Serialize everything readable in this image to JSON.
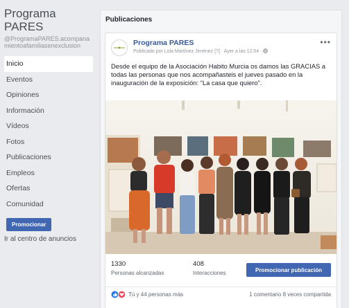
{
  "sidebar": {
    "page_name": "Programa PARES",
    "page_handle": "@ProgramaPARES.acompanamientoafamiliasenexclusion",
    "nav_items": [
      {
        "label": "Inicio"
      },
      {
        "label": "Eventos"
      },
      {
        "label": "Opiniones"
      },
      {
        "label": "Información"
      },
      {
        "label": "Vídeos"
      },
      {
        "label": "Fotos"
      },
      {
        "label": "Publicaciones"
      },
      {
        "label": "Empleos"
      },
      {
        "label": "Ofertas"
      },
      {
        "label": "Comunidad"
      }
    ],
    "promote_label": "Promocionar",
    "ads_center_label": "Ir al centro de anuncios"
  },
  "main": {
    "section_title": "Publicaciones",
    "post": {
      "author": "Programa PARES",
      "meta": "Publicado por Lola Martínez Jiménez [?] · Ayer a las 12:54 · ",
      "more_label": "•••",
      "text": "Desde el equipo de la Asociación Habito Murcia os damos las GRACIAS a todas las personas que nos acompañasteis el jueves pasado en la inauguración de la exposición: “La casa que quiero”.",
      "stats": {
        "reach_value": "1330",
        "reach_label": "Personas alcanzadas",
        "interactions_value": "408",
        "interactions_label": "Interacciones",
        "boost_label": "Promocionar publicación"
      },
      "reactions": {
        "summary": "Tú y 44 personas más",
        "comments_shares": "1 comentario  8 veces compartida"
      }
    }
  },
  "colors": {
    "accent": "#4267b2",
    "link": "#385898",
    "background": "#e9ebee"
  }
}
